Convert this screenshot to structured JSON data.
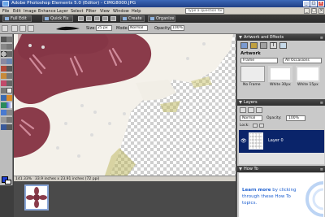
{
  "window": {
    "title": "Adobe Photoshop Elements 5.0 (Editor) - CIMG8000.JPG",
    "controls": [
      "_",
      "□",
      "×"
    ]
  },
  "menu": {
    "items": [
      "File",
      "Edit",
      "Image",
      "Enhance",
      "Layer",
      "Select",
      "Filter",
      "View",
      "Window",
      "Help"
    ],
    "help_placeholder": "Type a question for help"
  },
  "shortcuts": {
    "full_edit": "Full Edit",
    "quick_fix": "Quick Fix",
    "create": "Create",
    "organize": "Organize"
  },
  "options_bar": {
    "size_label": "Size:",
    "size_value": "25 px",
    "mode_label": "Mode:",
    "mode_value": "Normal",
    "opacity_label": "Opacity:",
    "opacity_value": "100%"
  },
  "artwork_panel": {
    "title": "Artwork and Effects",
    "section": "Artwork",
    "category": "Frame",
    "filter": "All Occasions",
    "items": [
      "No Frame",
      "White 30px",
      "White 15px"
    ]
  },
  "layers_panel": {
    "title": "Layers",
    "blend_mode": "Normal",
    "opacity_label": "Opacity:",
    "opacity_value": "100%",
    "lock_label": "Lock:",
    "layer_name": "Layer 0"
  },
  "howto_panel": {
    "title": "How To",
    "text_bold": "Learn more",
    "text_1": "by clicking",
    "text_2": "through these How To",
    "text_3": "topics."
  },
  "status": {
    "zoom": "141.33%",
    "doc_info": "33.9 inches x 23.91 inches (72 ppi)"
  },
  "colors": {
    "felt": "#f4f1ea",
    "petal": "#8a3b4a",
    "selected_layer": "#0a246a",
    "howto_link": "#1d5fd0"
  }
}
